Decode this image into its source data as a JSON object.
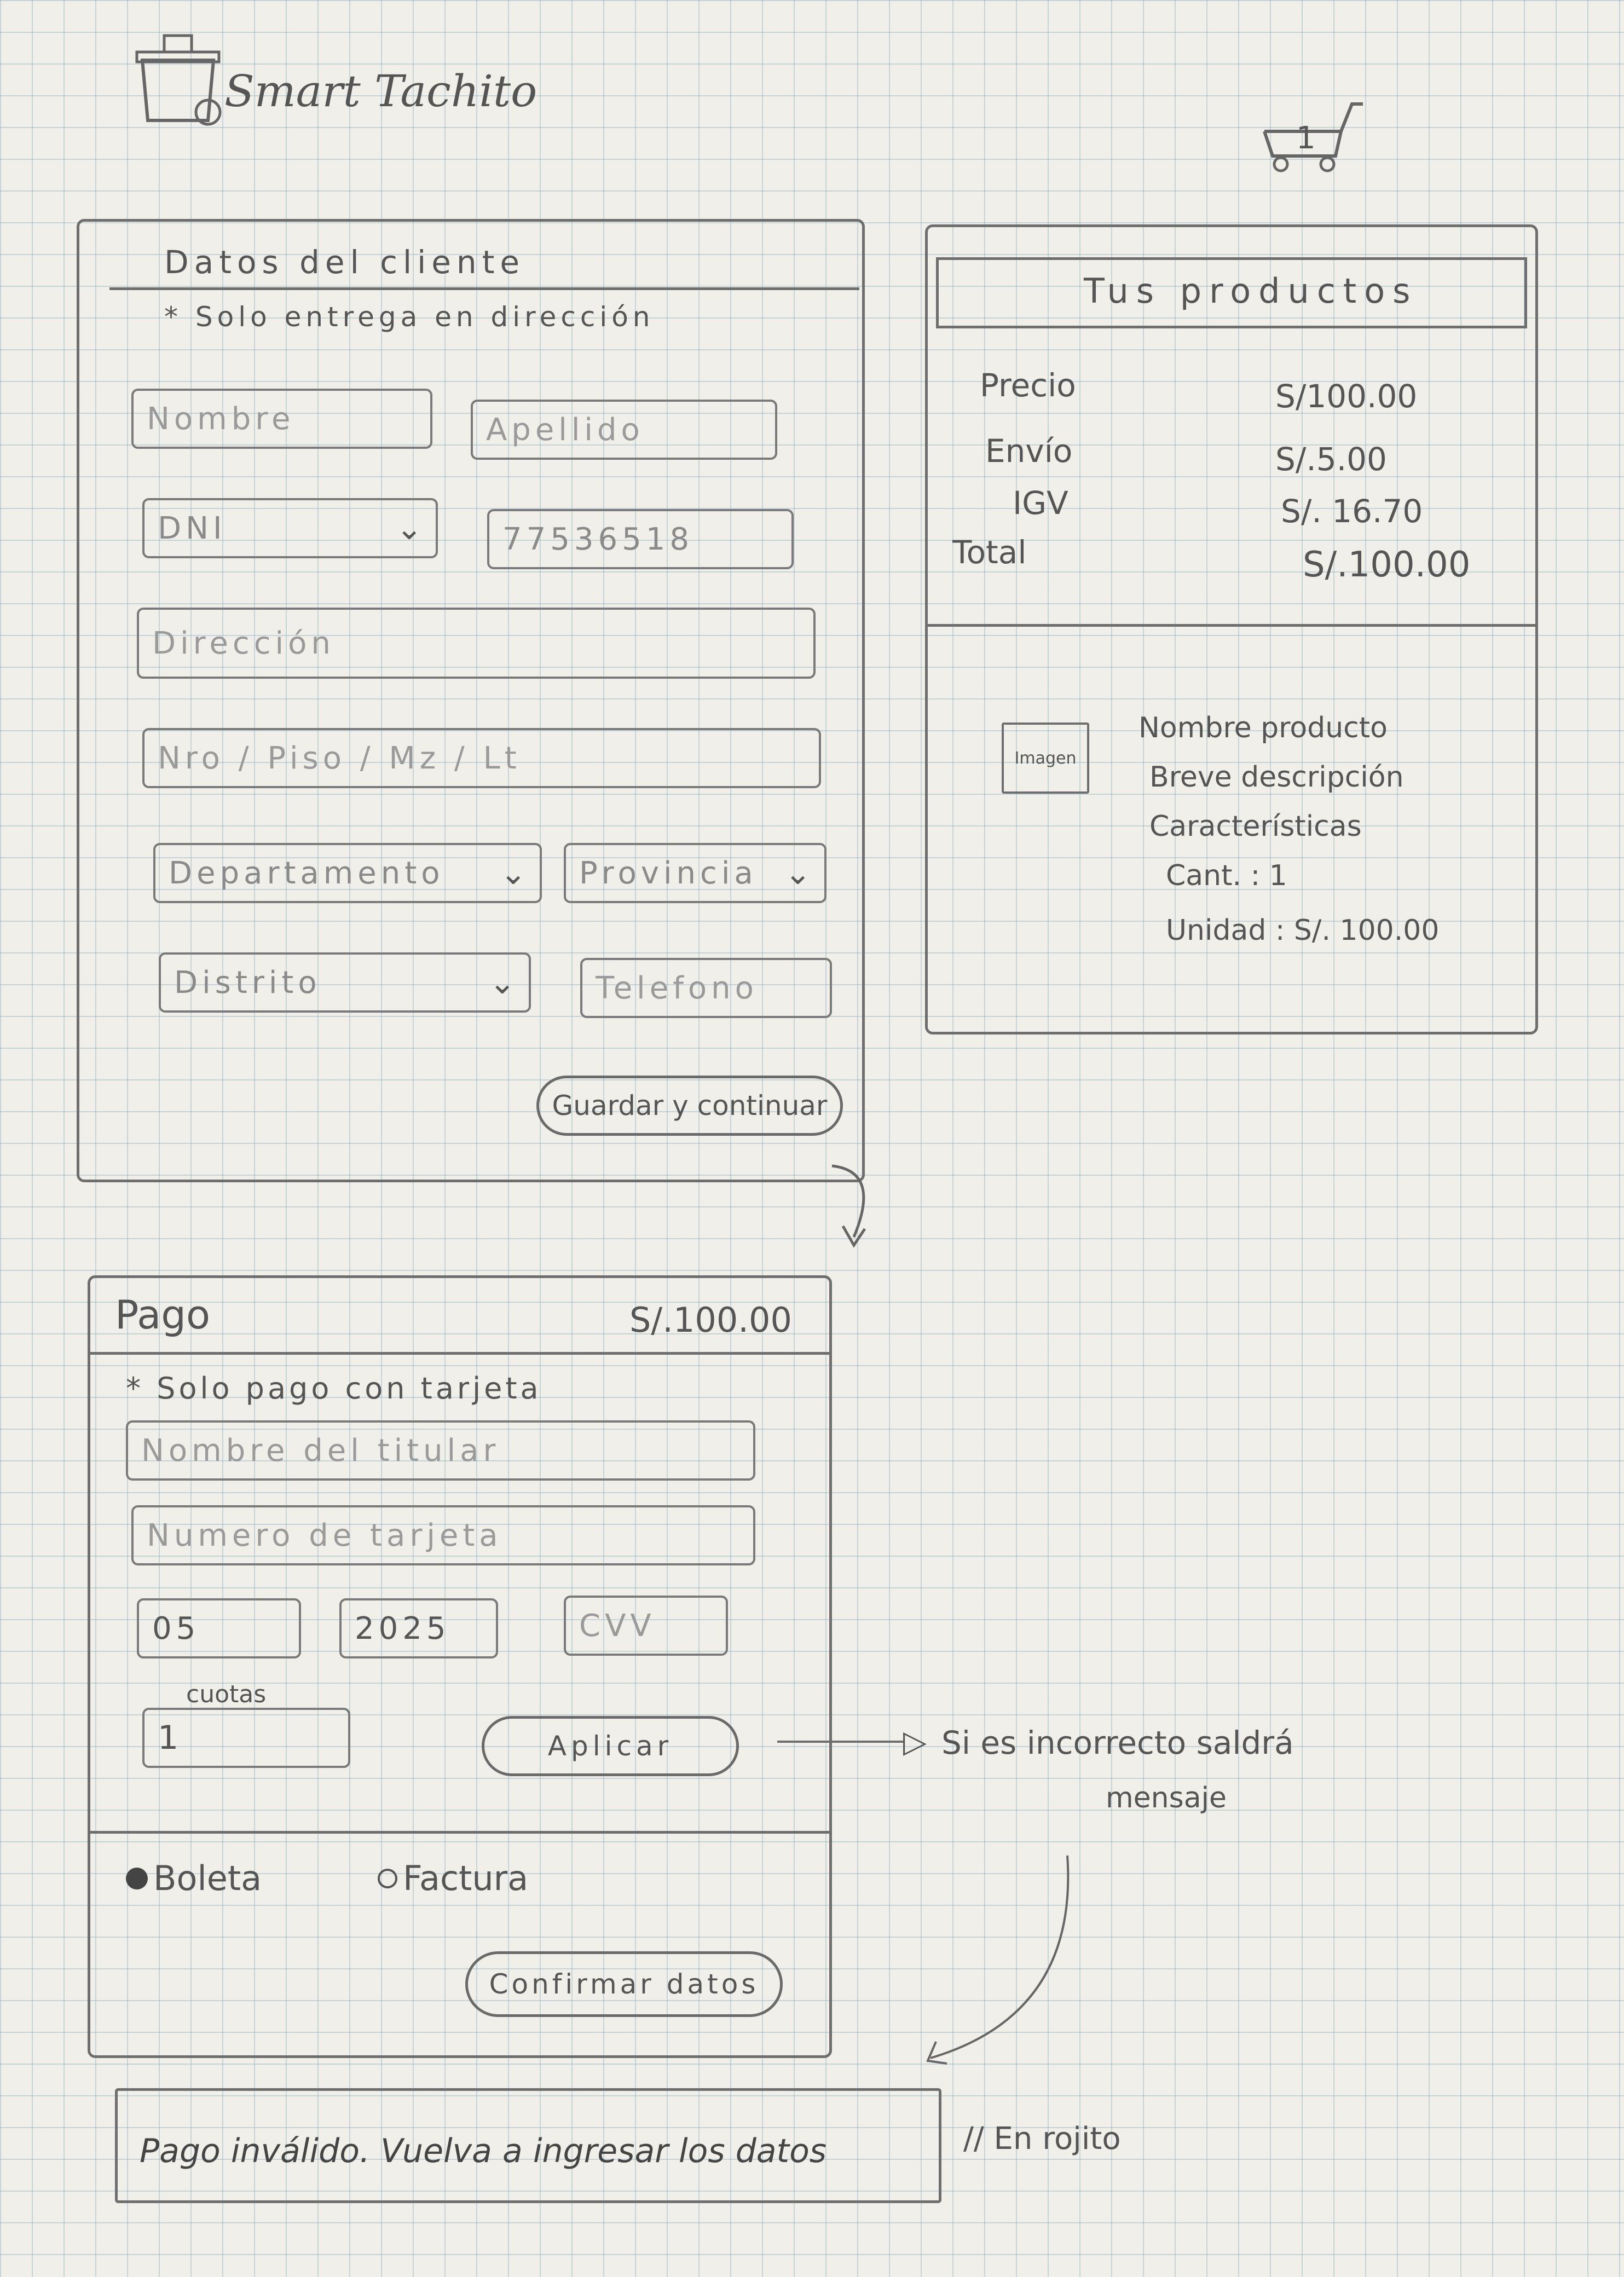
{
  "header": {
    "brand": "Smart Tachito",
    "cart_count": "1"
  },
  "client": {
    "title": "Datos del cliente",
    "note": "* Solo entrega en dirección",
    "nombre_placeholder": "Nombre",
    "apellido_placeholder": "Apellido",
    "doc_type": "DNI",
    "doc_number": "77536518",
    "direccion_placeholder": "Dirección",
    "piso_placeholder": "Nro / Piso / Mz / Lt",
    "departamento": "Departamento",
    "provincia": "Provincia",
    "distrito": "Distrito",
    "telefono_placeholder": "Telefono",
    "save_button": "Guardar y continuar"
  },
  "products": {
    "title": "Tus productos",
    "summary": [
      {
        "label": "Precio",
        "value": "S/100.00"
      },
      {
        "label": "Envío",
        "value": "S/.5.00"
      },
      {
        "label": "IGV",
        "value": "S/. 16.70"
      },
      {
        "label": "Total",
        "value": "S/.100.00"
      }
    ],
    "item": {
      "image_label": "Imagen",
      "name": "Nombre producto",
      "description": "Breve descripción",
      "features": "Características",
      "quantity": "Cant. : 1",
      "unit_price": "Unidad : S/. 100.00"
    }
  },
  "payment": {
    "title": "Pago",
    "amount": "S/.100.00",
    "note": "* Solo pago con tarjeta",
    "holder_placeholder": "Nombre del titular",
    "card_placeholder": "Numero de tarjeta",
    "month": "05",
    "year": "2025",
    "cvv_placeholder": "CVV",
    "cuotas_label": "cuotas",
    "cuotas_value": "1",
    "apply_button": "Aplicar",
    "receipt_options": [
      "Boleta",
      "Factura"
    ],
    "confirm_button": "Confirmar datos"
  },
  "annotations": {
    "apply_note_line1": "Si es incorrecto saldrá",
    "apply_note_line2": "mensaje",
    "error_note": "// En rojito"
  },
  "error": {
    "message": "Pago inválido. Vuelva a ingresar los datos"
  }
}
